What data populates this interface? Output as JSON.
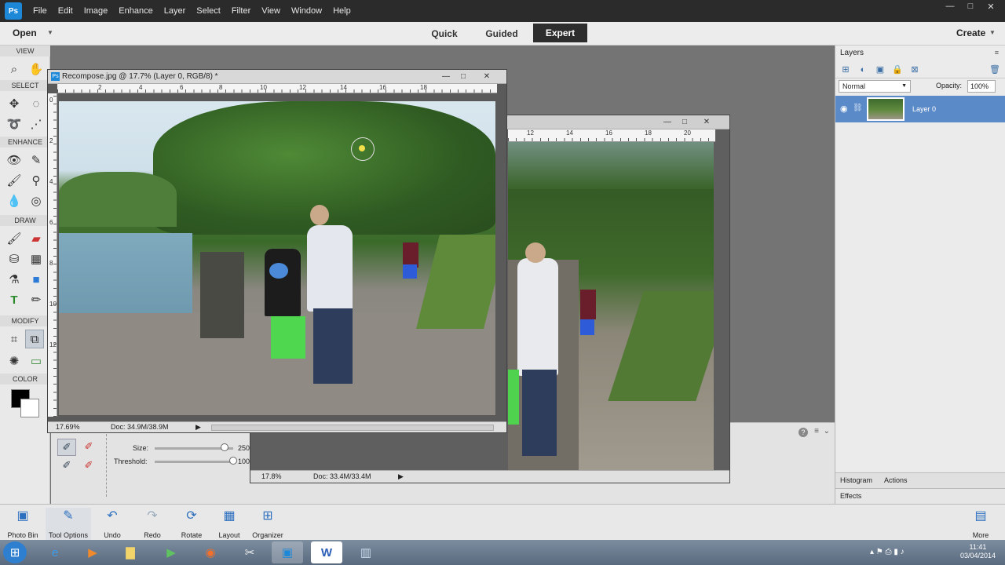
{
  "menubar": {
    "logo": "Ps",
    "items": [
      "File",
      "Edit",
      "Image",
      "Enhance",
      "Layer",
      "Select",
      "Filter",
      "View",
      "Window",
      "Help"
    ],
    "window_controls": [
      "—",
      "□",
      "✕"
    ]
  },
  "modebar": {
    "open_label": "Open",
    "modes": [
      "Quick",
      "Guided",
      "Expert"
    ],
    "active_mode": "Expert",
    "create_label": "Create"
  },
  "toolbox": {
    "sections": [
      "VIEW",
      "SELECT",
      "ENHANCE",
      "DRAW",
      "MODIFY",
      "COLOR"
    ],
    "tools": {
      "view": [
        "zoom-icon",
        "hand-icon"
      ],
      "select": [
        "move-icon",
        "marquee-icon",
        "lasso-icon",
        "quick-selection-icon"
      ],
      "enhance": [
        "red-eye-icon",
        "spot-healing-icon",
        "smart-brush-icon",
        "clone-stamp-icon",
        "blur-icon",
        "sponge-icon"
      ],
      "draw": [
        "brush-icon",
        "eraser-icon",
        "paint-bucket-icon",
        "gradient-icon",
        "eyedropper-icon",
        "shape-icon",
        "type-icon",
        "pencil-icon"
      ],
      "modify": [
        "crop-icon",
        "recompose-icon",
        "content-aware-move-icon",
        "straighten-icon"
      ]
    },
    "foreground_color": "#000000",
    "background_color": "#ffffff"
  },
  "doc_main": {
    "title": "Recompose.jpg @ 17.7% (Layer 0, RGB/8) *",
    "ruler_ticks": [
      "2",
      "4",
      "6",
      "8",
      "10",
      "12",
      "14",
      "16",
      "18"
    ],
    "vruler_ticks": [
      "0",
      "2",
      "4",
      "6",
      "8",
      "10",
      "12"
    ],
    "zoom": "17.69%",
    "doc_size": "Doc: 34.9M/38.9M"
  },
  "doc_second": {
    "ruler_ticks": [
      "12",
      "14",
      "16",
      "18",
      "20"
    ],
    "zoom": "17.8%",
    "doc_size": "Doc: 33.4M/33.4M"
  },
  "tool_options": {
    "size_label": "Size:",
    "size_value": "250",
    "size_level": 0.89,
    "threshold_label": "Threshold:",
    "threshold_value": "100",
    "threshold_level": 1.0
  },
  "layers_panel": {
    "tab": "Layers",
    "blend_mode": "Normal",
    "opacity_label": "Opacity:",
    "opacity_value": "100%",
    "layers": [
      {
        "name": "Layer 0"
      }
    ],
    "bottom_tabs": [
      "Histogram",
      "Actions"
    ],
    "effects_label": "Effects"
  },
  "bottombar": {
    "items": [
      {
        "label": "Photo Bin",
        "icon": "photo-bin-icon"
      },
      {
        "label": "Tool Options",
        "icon": "tool-options-icon"
      },
      {
        "label": "Undo",
        "icon": "undo-icon"
      },
      {
        "label": "Redo",
        "icon": "redo-icon"
      },
      {
        "label": "Rotate",
        "icon": "rotate-icon"
      },
      {
        "label": "Layout",
        "icon": "layout-icon"
      },
      {
        "label": "Organizer",
        "icon": "organizer-icon"
      }
    ],
    "more_label": "More"
  },
  "taskbar": {
    "time": "11:41",
    "date": "03/04/2014"
  },
  "colors": {
    "accent_selected_layer": "#5b8ac8",
    "expert_mode_bg": "#2d2d2d"
  }
}
